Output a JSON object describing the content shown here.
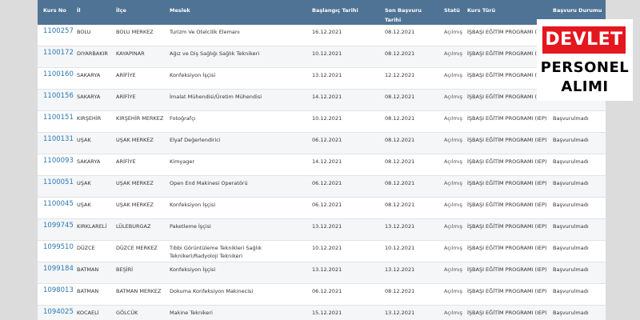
{
  "table": {
    "headers": {
      "kurs_no": "Kurs No",
      "il": "İl",
      "ilce": "İlçe",
      "meslek": "Meslek",
      "baslangic": "Başlangıç Tarihi",
      "son_basvuru": "Son Başvuru Tarihi",
      "statu": "Statü",
      "kurs_turu": "Kurs Türü",
      "basvuru_durumu": "Başvuru Durumu"
    },
    "rows": [
      {
        "kurs_no": "1100257",
        "il": "BOLU",
        "ilce": "BOLU MERKEZ",
        "meslek": "Turizm Ve Otelcilik Elemanı",
        "baslangic": "16.12.2021",
        "son_basvuru": "08.12.2021",
        "statu": "Açılmış",
        "kurs_turu": "İŞBAŞI EĞİTİM PROGRAMI (IEP)",
        "basvuru_durumu": ""
      },
      {
        "kurs_no": "1100172",
        "il": "DIYARBAKIR",
        "ilce": "KAYAPINAR",
        "meslek": "Ağız ve Diş Sağlığı Sağlık Teknikeri",
        "baslangic": "10.12.2021",
        "son_basvuru": "08.12.2021",
        "statu": "Açılmış",
        "kurs_turu": "İŞBAŞI EĞİTİM PROGRAMI (IEP)",
        "basvuru_durumu": ""
      },
      {
        "kurs_no": "1100160",
        "il": "SAKARYA",
        "ilce": "ARİFİYE",
        "meslek": "Konfeksiyon İşçisi",
        "baslangic": "13.12.2021",
        "son_basvuru": "12.12.2021",
        "statu": "Açılmış",
        "kurs_turu": "İŞBAŞI EĞİTİM PROGRAMI (IEP)",
        "basvuru_durumu": ""
      },
      {
        "kurs_no": "1100156",
        "il": "SAKARYA",
        "ilce": "ARİFİYE",
        "meslek": "İmalat Mühendisi/Üretim Mühendisi",
        "baslangic": "14.12.2021",
        "son_basvuru": "08.12.2021",
        "statu": "Açılmış",
        "kurs_turu": "İŞBAŞI EĞİTİM PROGRAMI (IEP)",
        "basvuru_durumu": ""
      },
      {
        "kurs_no": "1100151",
        "il": "KIRŞEHİR",
        "ilce": "KIRŞEHİR MERKEZ",
        "meslek": "Fotoğrafçı",
        "baslangic": "10.12.2021",
        "son_basvuru": "08.12.2021",
        "statu": "Açılmış",
        "kurs_turu": "İŞBAŞI EĞİTİM PROGRAMI (IEP)",
        "basvuru_durumu": "Başvurulmadı"
      },
      {
        "kurs_no": "1100131",
        "il": "UŞAK",
        "ilce": "UŞAK MERKEZ",
        "meslek": "Elyaf Değerlendirici",
        "baslangic": "06.12.2021",
        "son_basvuru": "08.12.2021",
        "statu": "Açılmış",
        "kurs_turu": "İŞBAŞI EĞİTİM PROGRAMI (IEP)",
        "basvuru_durumu": "Başvurulmadı"
      },
      {
        "kurs_no": "1100093",
        "il": "SAKARYA",
        "ilce": "ARİFİYE",
        "meslek": "Kimyager",
        "baslangic": "14.12.2021",
        "son_basvuru": "08.12.2021",
        "statu": "Açılmış",
        "kurs_turu": "İŞBAŞI EĞİTİM PROGRAMI (IEP)",
        "basvuru_durumu": "Başvurulmadı"
      },
      {
        "kurs_no": "1100051",
        "il": "UŞAK",
        "ilce": "UŞAK MERKEZ",
        "meslek": "Open End Makinesi Operatörü",
        "baslangic": "06.12.2021",
        "son_basvuru": "08.12.2021",
        "statu": "Açılmış",
        "kurs_turu": "İŞBAŞI EĞİTİM PROGRAMI (IEP)",
        "basvuru_durumu": "Başvurulmadı"
      },
      {
        "kurs_no": "1100045",
        "il": "UŞAK",
        "ilce": "UŞAK MERKEZ",
        "meslek": "Konfeksiyon İşçisi",
        "baslangic": "06.12.2021",
        "son_basvuru": "08.12.2021",
        "statu": "Açılmış",
        "kurs_turu": "İŞBAŞI EĞİTİM PROGRAMI (IEP)",
        "basvuru_durumu": "Başvurulmadı"
      },
      {
        "kurs_no": "1099745",
        "il": "KIRKLARELİ",
        "ilce": "LÜLEBURGAZ",
        "meslek": "Paketleme İşçisi",
        "baslangic": "13.12.2021",
        "son_basvuru": "13.12.2021",
        "statu": "Açılmış",
        "kurs_turu": "İŞBAŞI EĞİTİM PROGRAMI (IEP)",
        "basvuru_durumu": "Başvurulmadı"
      },
      {
        "kurs_no": "1099510",
        "il": "DÜZCE",
        "ilce": "DÜZCE MERKEZ",
        "meslek": "Tıbbi Görüntüleme Teknikleri Sağlık Teknikeri/Radyoloji Teknikeri",
        "baslangic": "10.12.2021",
        "son_basvuru": "10.12.2021",
        "statu": "Açılmış",
        "kurs_turu": "İŞBAŞI EĞİTİM PROGRAMI (IEP)",
        "basvuru_durumu": "Başvurulmadı"
      },
      {
        "kurs_no": "1099184",
        "il": "BATMAN",
        "ilce": "BEŞİRİ",
        "meslek": "Konfeksiyon İşçisi",
        "baslangic": "13.12.2021",
        "son_basvuru": "13.12.2021",
        "statu": "Açılmış",
        "kurs_turu": "İŞBAŞI EĞİTİM PROGRAMI (IEP)",
        "basvuru_durumu": "Başvurulmadı"
      },
      {
        "kurs_no": "1098013",
        "il": "BATMAN",
        "ilce": "BATMAN MERKEZ",
        "meslek": "Dokuma Konfeksiyon Makinecisi",
        "baslangic": "06.12.2021",
        "son_basvuru": "08.12.2021",
        "statu": "Açılmış",
        "kurs_turu": "İŞBAŞI EĞİTİM PROGRAMI (IEP)",
        "basvuru_durumu": "Başvurulmadı"
      },
      {
        "kurs_no": "1094025",
        "il": "KOCAELİ",
        "ilce": "GÖLCÜK",
        "meslek": "Makine Teknikeri",
        "baslangic": "15.12.2021",
        "son_basvuru": "13.12.2021",
        "statu": "Açılmış",
        "kurs_turu": "İŞBAŞI EĞİTİM PROGRAMI (IEP)",
        "basvuru_durumu": "Başvurulmadı"
      }
    ]
  },
  "badge": {
    "line1": "DEVLET",
    "line2": "PERSONEL",
    "line3": "ALIMI"
  }
}
